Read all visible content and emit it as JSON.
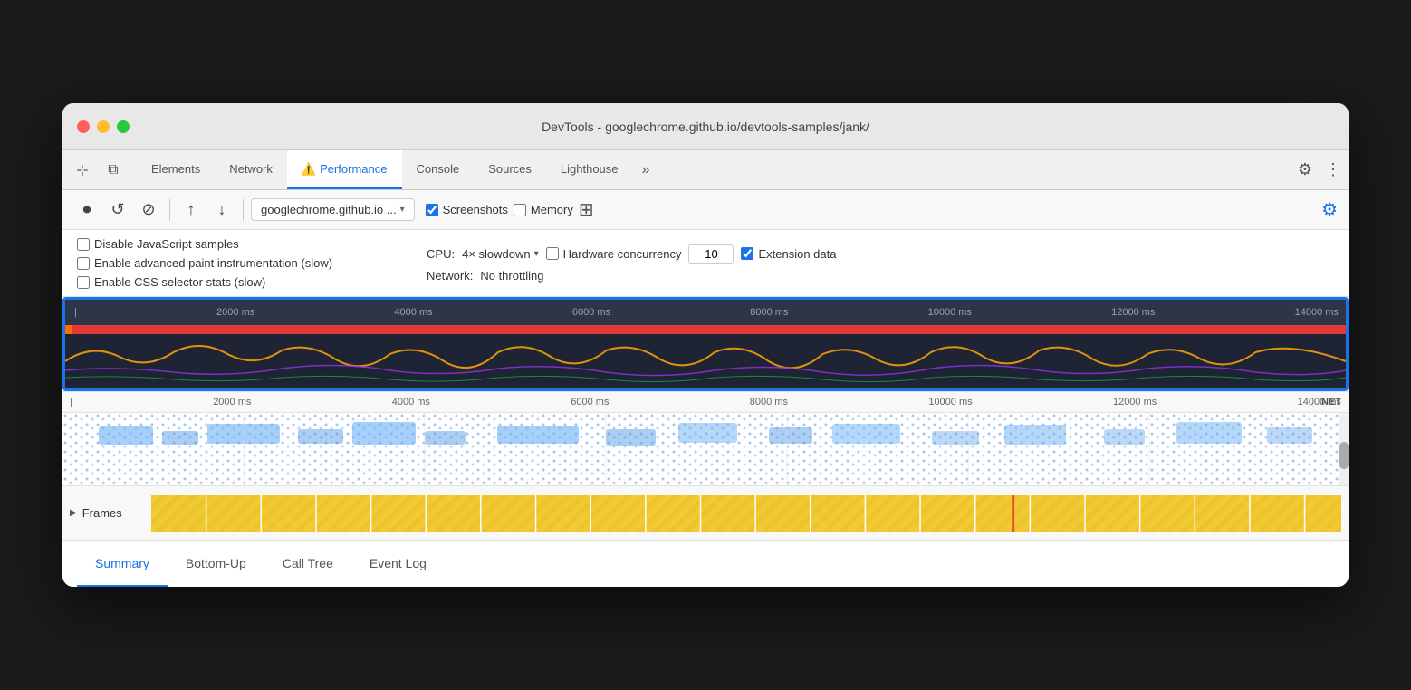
{
  "window": {
    "title": "DevTools - googlechrome.github.io/devtools-samples/jank/"
  },
  "tabs": {
    "items": [
      {
        "label": "Elements",
        "active": false,
        "warning": false
      },
      {
        "label": "Network",
        "active": false,
        "warning": false
      },
      {
        "label": "Performance",
        "active": true,
        "warning": true
      },
      {
        "label": "Console",
        "active": false,
        "warning": false
      },
      {
        "label": "Sources",
        "active": false,
        "warning": false
      },
      {
        "label": "Lighthouse",
        "active": false,
        "warning": false
      }
    ],
    "more_label": "»"
  },
  "toolbar": {
    "url": "googlechrome.github.io ...",
    "screenshots_label": "Screenshots",
    "memory_label": "Memory",
    "screenshots_checked": true,
    "memory_checked": false
  },
  "settings": {
    "disable_js_label": "Disable JavaScript samples",
    "advanced_paint_label": "Enable advanced paint instrumentation (slow)",
    "css_stats_label": "Enable CSS selector stats (slow)",
    "cpu_label": "CPU:",
    "cpu_value": "4× slowdown",
    "network_label": "Network:",
    "network_value": "No throttling",
    "hw_concurrency_label": "Hardware concurrency",
    "hw_concurrency_value": "10",
    "ext_data_label": "Extension data"
  },
  "timeline": {
    "ruler_marks": [
      "2000 ms",
      "4000 ms",
      "6000 ms",
      "8000 ms",
      "10000 ms",
      "12000 ms",
      "14000 ms"
    ],
    "ruler_marks2": [
      "2000 ms",
      "4000 ms",
      "6000 ms",
      "8000 ms",
      "10000 ms",
      "12000 ms",
      "14000 ms"
    ],
    "net_label": "NET",
    "frames_label": "Frames"
  },
  "bottom_tabs": {
    "items": [
      {
        "label": "Summary",
        "active": true
      },
      {
        "label": "Bottom-Up",
        "active": false
      },
      {
        "label": "Call Tree",
        "active": false
      },
      {
        "label": "Event Log",
        "active": false
      }
    ]
  }
}
